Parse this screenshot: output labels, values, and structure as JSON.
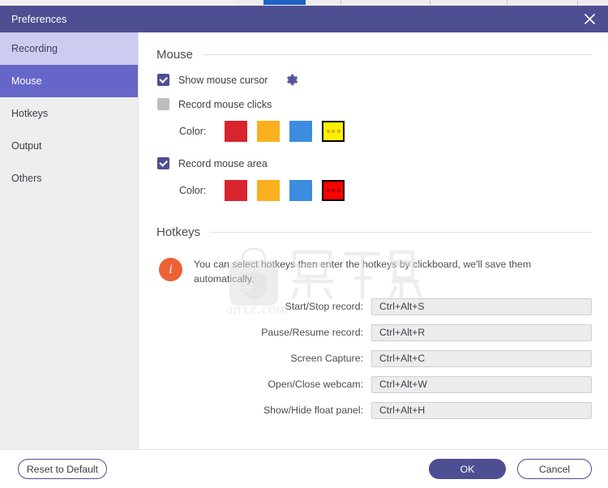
{
  "window": {
    "title": "Preferences",
    "close_icon": "close-icon",
    "accent_color": "#4e4e93",
    "active_nav_color": "#6666c9",
    "hover_nav_color": "#ccccf0"
  },
  "sidebar": {
    "items": [
      {
        "label": "Recording",
        "state": "hover"
      },
      {
        "label": "Mouse",
        "state": "active"
      },
      {
        "label": "Hotkeys",
        "state": "normal"
      },
      {
        "label": "Output",
        "state": "normal"
      },
      {
        "label": "Others",
        "state": "normal"
      }
    ]
  },
  "mouse_section": {
    "title": "Mouse",
    "show_cursor": {
      "label": "Show mouse cursor",
      "checked": true,
      "settings_icon": "gear-icon"
    },
    "record_clicks": {
      "label": "Record mouse clicks",
      "checked": false
    },
    "clicks_color": {
      "label": "Color:",
      "swatches": [
        {
          "name": "red",
          "color": "#d8242f",
          "selected": false
        },
        {
          "name": "orange",
          "color": "#fab01e",
          "selected": false
        },
        {
          "name": "blue",
          "color": "#3c8ce0",
          "selected": false
        },
        {
          "name": "yellow",
          "color": "#fff000",
          "selected": true,
          "dot_color": "#e0b400"
        }
      ]
    },
    "record_area": {
      "label": "Record mouse area",
      "checked": true
    },
    "area_color": {
      "label": "Color:",
      "swatches": [
        {
          "name": "red",
          "color": "#d8242f",
          "selected": false
        },
        {
          "name": "orange",
          "color": "#fab01e",
          "selected": false
        },
        {
          "name": "blue",
          "color": "#3c8ce0",
          "selected": false
        },
        {
          "name": "bright-red",
          "color": "#ff0000",
          "selected": true,
          "dot_color": "#b00000"
        }
      ]
    }
  },
  "hotkeys_section": {
    "title": "Hotkeys",
    "info_badge": "i",
    "info_text": "You can select hotkeys then enter the hotkeys by clickboard, we'll save them automatically.",
    "rows": [
      {
        "label": "Start/Stop record:",
        "value": "Ctrl+Alt+S"
      },
      {
        "label": "Pause/Resume record:",
        "value": "Ctrl+Alt+R"
      },
      {
        "label": "Screen Capture:",
        "value": "Ctrl+Alt+C"
      },
      {
        "label": "Open/Close webcam:",
        "value": "Ctrl+Alt+W"
      },
      {
        "label": "Show/Hide float panel:",
        "value": "Ctrl+Alt+H"
      }
    ]
  },
  "footer": {
    "reset_label": "Reset to Default",
    "ok_label": "OK",
    "cancel_label": "Cancel"
  },
  "watermark": {
    "cjk_logo": "安",
    "cjk_text": "安下载",
    "site": "anxz.com"
  }
}
